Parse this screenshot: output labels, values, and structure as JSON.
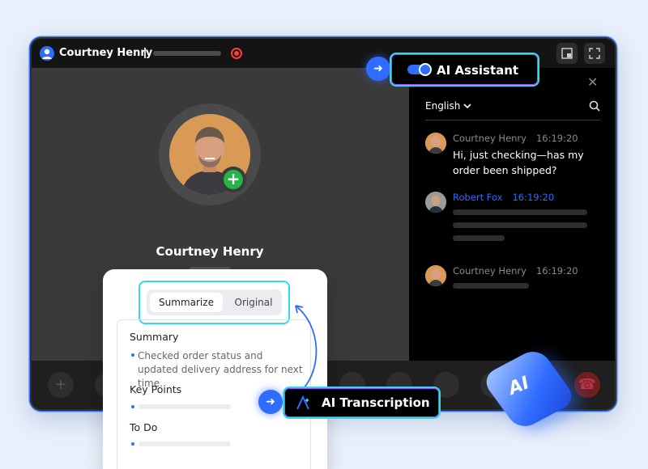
{
  "titlebar": {
    "caller_name": "Courtney Henry"
  },
  "call": {
    "caller_name": "Courtney Henry"
  },
  "assistant": {
    "label": "AI Assistant",
    "toggle_on": true,
    "language": "English",
    "messages": [
      {
        "name": "Courtney Henry",
        "time": "16:19:20",
        "text": "Hi, just checking—has my order been shipped?"
      },
      {
        "name": "Robert Fox",
        "time": "16:19:20",
        "text": ""
      },
      {
        "name": "Courtney Henry",
        "time": "16:19:20",
        "text": ""
      }
    ]
  },
  "transcription": {
    "label": "AI Transcription",
    "tabs": [
      "Summarize",
      "Original"
    ],
    "active_tab": "Summarize",
    "summary_title": "Summary",
    "summary_text": "Checked order status and updated delivery address for next time.",
    "key_points_title": "Key Points",
    "todo_title": "To Do"
  },
  "badge": {
    "label": "AI"
  },
  "colors": {
    "accent": "#2f6cff",
    "highlight": "#35d7f0",
    "glow": "#a24bff",
    "agent_name": "#2f6cff"
  }
}
